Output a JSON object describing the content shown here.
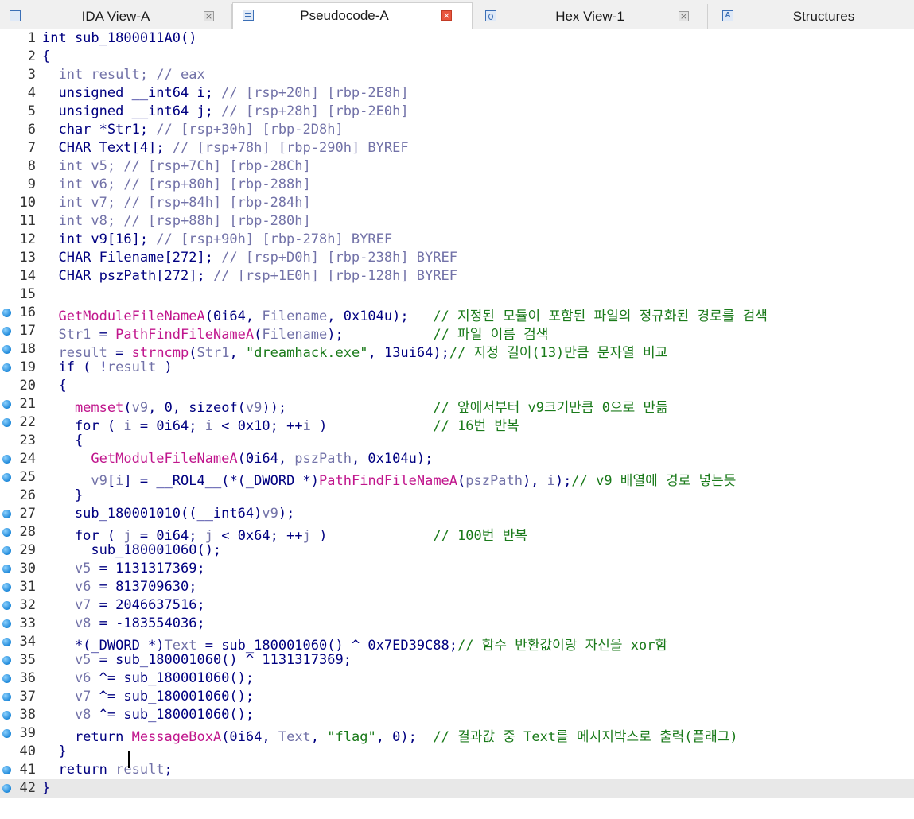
{
  "tabs": [
    {
      "label": "IDA View-A",
      "active": false,
      "icon": "listing-icon",
      "close": "×"
    },
    {
      "label": "Pseudocode-A",
      "active": true,
      "icon": "pseudocode-icon",
      "close": "×"
    },
    {
      "label": "Hex View-1",
      "active": false,
      "icon": "hex-icon",
      "close": "×"
    },
    {
      "label": "Structures",
      "active": false,
      "icon": "structures-icon",
      "glyph": "A"
    }
  ],
  "code": {
    "current_line": 42,
    "lines": [
      {
        "n": "1",
        "bp": false,
        "t": [
          [
            "k",
            "int sub_1800011A0()"
          ]
        ]
      },
      {
        "n": "2",
        "bp": false,
        "t": [
          [
            "k",
            "{"
          ]
        ]
      },
      {
        "n": "3",
        "bp": false,
        "t": [
          [
            "v",
            "  int result; // eax"
          ]
        ]
      },
      {
        "n": "4",
        "bp": false,
        "t": [
          [
            "k",
            "  unsigned __int64 i; "
          ],
          [
            "v",
            "// [rsp+20h] [rbp-2E8h]"
          ]
        ]
      },
      {
        "n": "5",
        "bp": false,
        "t": [
          [
            "k",
            "  unsigned __int64 j; "
          ],
          [
            "v",
            "// [rsp+28h] [rbp-2E0h]"
          ]
        ]
      },
      {
        "n": "6",
        "bp": false,
        "t": [
          [
            "k",
            "  char *Str1; "
          ],
          [
            "v",
            "// [rsp+30h] [rbp-2D8h]"
          ]
        ]
      },
      {
        "n": "7",
        "bp": false,
        "t": [
          [
            "k",
            "  CHAR Text[4]; "
          ],
          [
            "v",
            "// [rsp+78h] [rbp-290h] BYREF"
          ]
        ]
      },
      {
        "n": "8",
        "bp": false,
        "t": [
          [
            "v",
            "  int v5; // [rsp+7Ch] [rbp-28Ch]"
          ]
        ]
      },
      {
        "n": "9",
        "bp": false,
        "t": [
          [
            "v",
            "  int v6; // [rsp+80h] [rbp-288h]"
          ]
        ]
      },
      {
        "n": "10",
        "bp": false,
        "t": [
          [
            "v",
            "  int v7; // [rsp+84h] [rbp-284h]"
          ]
        ]
      },
      {
        "n": "11",
        "bp": false,
        "t": [
          [
            "v",
            "  int v8; // [rsp+88h] [rbp-280h]"
          ]
        ]
      },
      {
        "n": "12",
        "bp": false,
        "t": [
          [
            "k",
            "  int v9[16]; "
          ],
          [
            "v",
            "// [rsp+90h] [rbp-278h] BYREF"
          ]
        ]
      },
      {
        "n": "13",
        "bp": false,
        "t": [
          [
            "k",
            "  CHAR Filename[272]; "
          ],
          [
            "v",
            "// [rsp+D0h] [rbp-238h] BYREF"
          ]
        ]
      },
      {
        "n": "14",
        "bp": false,
        "t": [
          [
            "k",
            "  CHAR pszPath[272]; "
          ],
          [
            "v",
            "// [rsp+1E0h] [rbp-128h] BYREF"
          ]
        ]
      },
      {
        "n": "15",
        "bp": false,
        "t": [
          [
            "k",
            ""
          ]
        ]
      },
      {
        "n": "16",
        "bp": true,
        "t": [
          [
            "f",
            "  GetModuleFileNameA"
          ],
          [
            "k",
            "(0i64, "
          ],
          [
            "v",
            "Filename"
          ],
          [
            "k",
            ", 0x104u);   "
          ],
          [
            "c",
            "// 지정된 모듈이 포함된 파일의 정규화된 경로를 검색"
          ]
        ]
      },
      {
        "n": "17",
        "bp": true,
        "t": [
          [
            "v",
            "  Str1"
          ],
          [
            "k",
            " = "
          ],
          [
            "f",
            "PathFindFileNameA"
          ],
          [
            "k",
            "("
          ],
          [
            "v",
            "Filename"
          ],
          [
            "k",
            ");           "
          ],
          [
            "c",
            "// 파일 이름 검색"
          ]
        ]
      },
      {
        "n": "18",
        "bp": true,
        "t": [
          [
            "v",
            "  result"
          ],
          [
            "k",
            " = "
          ],
          [
            "f",
            "strncmp"
          ],
          [
            "k",
            "("
          ],
          [
            "v",
            "Str1"
          ],
          [
            "k",
            ", "
          ],
          [
            "s",
            "\"dreamhack.exe\""
          ],
          [
            "k",
            ", 13ui64);"
          ],
          [
            "c",
            "// 지정 길이(13)만큼 문자열 비교"
          ]
        ]
      },
      {
        "n": "19",
        "bp": true,
        "t": [
          [
            "k",
            "  if ( !"
          ],
          [
            "v",
            "result"
          ],
          [
            "k",
            " )"
          ]
        ]
      },
      {
        "n": "20",
        "bp": false,
        "t": [
          [
            "k",
            "  {"
          ]
        ]
      },
      {
        "n": "21",
        "bp": true,
        "t": [
          [
            "f",
            "    memset"
          ],
          [
            "k",
            "("
          ],
          [
            "v",
            "v9"
          ],
          [
            "k",
            ", 0, sizeof("
          ],
          [
            "v",
            "v9"
          ],
          [
            "k",
            "));                  "
          ],
          [
            "c",
            "// 앞에서부터 v9크기만큼 0으로 만듦"
          ]
        ]
      },
      {
        "n": "22",
        "bp": true,
        "t": [
          [
            "k",
            "    for ( "
          ],
          [
            "v",
            "i"
          ],
          [
            "k",
            " = 0i64; "
          ],
          [
            "v",
            "i"
          ],
          [
            "k",
            " < 0x10; ++"
          ],
          [
            "v",
            "i"
          ],
          [
            "k",
            " )             "
          ],
          [
            "c",
            "// 16번 반복"
          ]
        ]
      },
      {
        "n": "23",
        "bp": false,
        "t": [
          [
            "k",
            "    {"
          ]
        ]
      },
      {
        "n": "24",
        "bp": true,
        "t": [
          [
            "f",
            "      GetModuleFileNameA"
          ],
          [
            "k",
            "(0i64, "
          ],
          [
            "v",
            "pszPath"
          ],
          [
            "k",
            ", 0x104u);"
          ]
        ]
      },
      {
        "n": "25",
        "bp": true,
        "t": [
          [
            "v",
            "      v9"
          ],
          [
            "k",
            "["
          ],
          [
            "v",
            "i"
          ],
          [
            "k",
            "] = __ROL4__(*(_DWORD *)"
          ],
          [
            "f",
            "PathFindFileNameA"
          ],
          [
            "k",
            "("
          ],
          [
            "v",
            "pszPath"
          ],
          [
            "k",
            "), "
          ],
          [
            "v",
            "i"
          ],
          [
            "k",
            ");"
          ],
          [
            "c",
            "// v9 배열에 경로 넣는듯"
          ]
        ]
      },
      {
        "n": "26",
        "bp": false,
        "t": [
          [
            "k",
            "    }"
          ]
        ]
      },
      {
        "n": "27",
        "bp": true,
        "t": [
          [
            "k",
            "    sub_180001010((__int64)"
          ],
          [
            "v",
            "v9"
          ],
          [
            "k",
            ");"
          ]
        ]
      },
      {
        "n": "28",
        "bp": true,
        "t": [
          [
            "k",
            "    for ( "
          ],
          [
            "v",
            "j"
          ],
          [
            "k",
            " = 0i64; "
          ],
          [
            "v",
            "j"
          ],
          [
            "k",
            " < 0x64; ++"
          ],
          [
            "v",
            "j"
          ],
          [
            "k",
            " )             "
          ],
          [
            "c",
            "// 100번 반복"
          ]
        ]
      },
      {
        "n": "29",
        "bp": true,
        "t": [
          [
            "k",
            "      sub_180001060();"
          ]
        ]
      },
      {
        "n": "30",
        "bp": true,
        "t": [
          [
            "v",
            "    v5"
          ],
          [
            "k",
            " = 1131317369;"
          ]
        ]
      },
      {
        "n": "31",
        "bp": true,
        "t": [
          [
            "v",
            "    v6"
          ],
          [
            "k",
            " = 813709630;"
          ]
        ]
      },
      {
        "n": "32",
        "bp": true,
        "t": [
          [
            "v",
            "    v7"
          ],
          [
            "k",
            " = 2046637516;"
          ]
        ]
      },
      {
        "n": "33",
        "bp": true,
        "t": [
          [
            "v",
            "    v8"
          ],
          [
            "k",
            " = -183554036;"
          ]
        ]
      },
      {
        "n": "34",
        "bp": true,
        "t": [
          [
            "k",
            "    *(_DWORD *)"
          ],
          [
            "v",
            "Text"
          ],
          [
            "k",
            " = sub_180001060() ^ 0x7ED39C88;"
          ],
          [
            "c",
            "// 함수 반환값이랑 자신을 xor함"
          ]
        ]
      },
      {
        "n": "35",
        "bp": true,
        "t": [
          [
            "v",
            "    v5"
          ],
          [
            "k",
            " = sub_180001060() ^ 1131317369;"
          ]
        ]
      },
      {
        "n": "36",
        "bp": true,
        "t": [
          [
            "v",
            "    v6"
          ],
          [
            "k",
            " ^= sub_180001060();"
          ]
        ]
      },
      {
        "n": "37",
        "bp": true,
        "t": [
          [
            "v",
            "    v7"
          ],
          [
            "k",
            " ^= sub_180001060();"
          ]
        ]
      },
      {
        "n": "38",
        "bp": true,
        "t": [
          [
            "v",
            "    v8"
          ],
          [
            "k",
            " ^= sub_180001060();"
          ]
        ]
      },
      {
        "n": "39",
        "bp": true,
        "t": [
          [
            "k",
            "    return "
          ],
          [
            "f",
            "MessageBoxA"
          ],
          [
            "k",
            "(0i64, "
          ],
          [
            "v",
            "Text"
          ],
          [
            "k",
            ", "
          ],
          [
            "s",
            "\"flag\""
          ],
          [
            "k",
            ", 0);  "
          ],
          [
            "c",
            "// 결과값 중 Text를 메시지박스로 출력(플래그)"
          ]
        ]
      },
      {
        "n": "40",
        "bp": false,
        "t": [
          [
            "k",
            "  }"
          ]
        ]
      },
      {
        "n": "41",
        "bp": true,
        "t": [
          [
            "k",
            "  return "
          ],
          [
            "v",
            "result"
          ],
          [
            "k",
            ";"
          ]
        ]
      },
      {
        "n": "42",
        "bp": true,
        "t": [
          [
            "k",
            "}"
          ]
        ]
      }
    ]
  },
  "colors": {
    "keyword": "#000080",
    "variable": "#7272a8",
    "function": "#c0158c",
    "comment": "#1a7a1a",
    "current_line_bg": "#e8e8e8"
  }
}
